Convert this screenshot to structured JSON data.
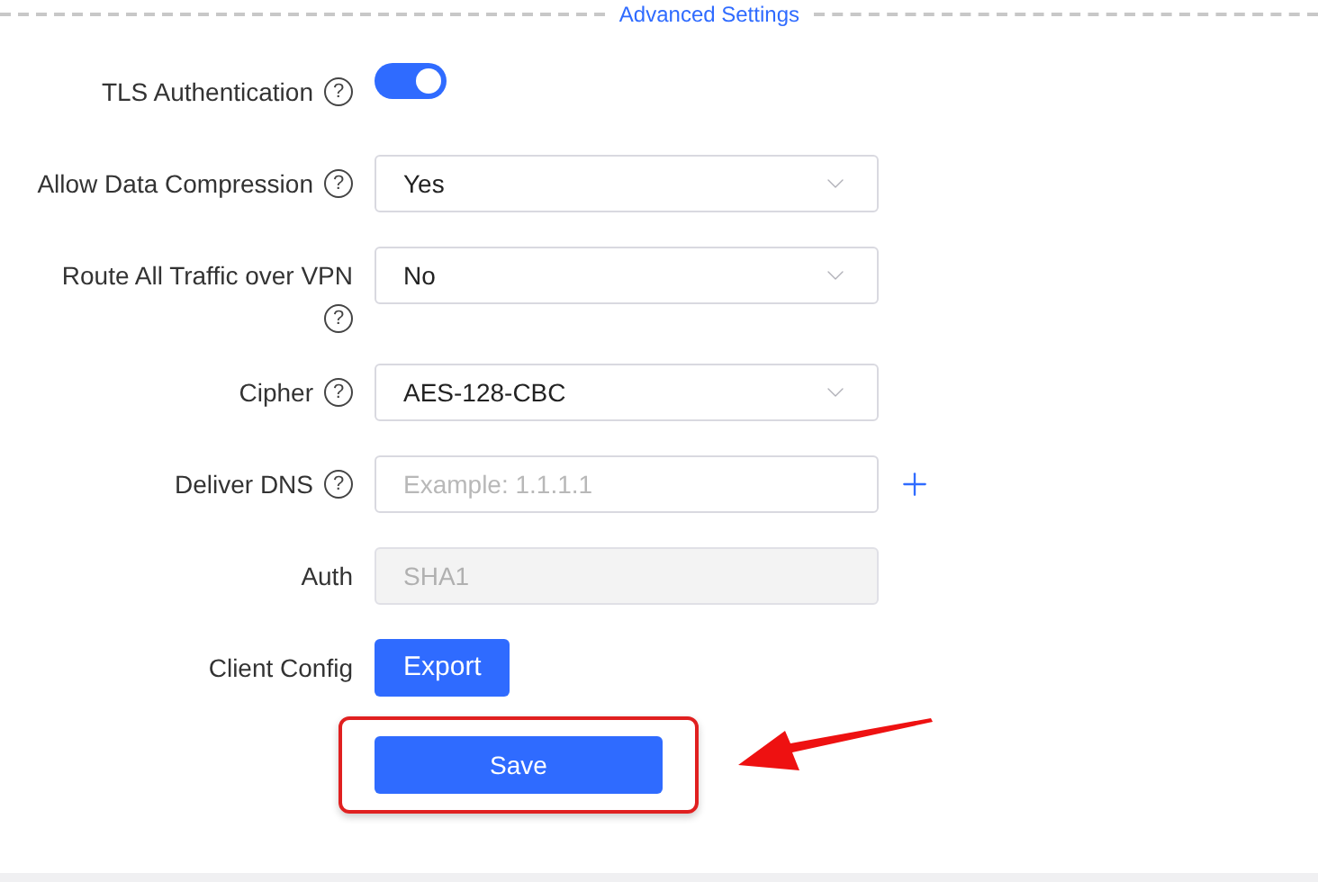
{
  "section_title": "Advanced Settings",
  "fields": [
    {
      "kind": "toggle",
      "label": "TLS Authentication",
      "help": "?",
      "on": true
    },
    {
      "kind": "select",
      "label": "Allow Data Compression",
      "help": "?",
      "value": "Yes"
    },
    {
      "kind": "select",
      "label": "Route All Traffic over VPN",
      "help": "?",
      "help_below": true,
      "value": "No"
    },
    {
      "kind": "select",
      "label": "Cipher",
      "help": "?",
      "value": "AES-128-CBC"
    },
    {
      "kind": "input",
      "label": "Deliver DNS",
      "help": "?",
      "placeholder": "Example: 1.1.1.1",
      "addable": true
    },
    {
      "kind": "readonly",
      "label": "Auth",
      "value": "SHA1",
      "disabled": true
    },
    {
      "kind": "button",
      "label": "Client Config",
      "value": "Export"
    }
  ],
  "save_button": "Save"
}
